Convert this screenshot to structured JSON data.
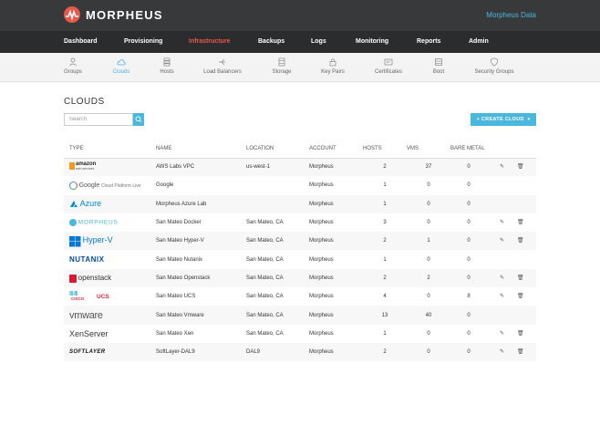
{
  "header": {
    "brand": "MORPHEUS",
    "tenant": "Morpheus Data"
  },
  "main_nav": [
    {
      "label": "Dashboard",
      "active": false
    },
    {
      "label": "Provisioning",
      "active": false
    },
    {
      "label": "Infrastructure",
      "active": true
    },
    {
      "label": "Backups",
      "active": false
    },
    {
      "label": "Logs",
      "active": false
    },
    {
      "label": "Monitoring",
      "active": false
    },
    {
      "label": "Reports",
      "active": false
    },
    {
      "label": "Admin",
      "active": false
    }
  ],
  "sub_nav": [
    {
      "label": "Groups",
      "icon": "groups-icon",
      "active": false
    },
    {
      "label": "Clouds",
      "icon": "cloud-icon",
      "active": true
    },
    {
      "label": "Hosts",
      "icon": "hosts-icon",
      "active": false
    },
    {
      "label": "Load Balancers",
      "icon": "load-balancer-icon",
      "active": false
    },
    {
      "label": "Storage",
      "icon": "storage-icon",
      "active": false
    },
    {
      "label": "Key Pairs",
      "icon": "lock-icon",
      "active": false
    },
    {
      "label": "Certificates",
      "icon": "certificate-icon",
      "active": false
    },
    {
      "label": "Boot",
      "icon": "boot-icon",
      "active": false
    },
    {
      "label": "Security Groups",
      "icon": "shield-icon",
      "active": false
    }
  ],
  "page": {
    "title": "CLOUDS",
    "search_placeholder": "Search",
    "create_button": "+ CREATE CLOUD",
    "create_dropdown_icon": "chevron-down-icon"
  },
  "table": {
    "headers": [
      "TYPE",
      "NAME",
      "LOCATION",
      "ACCOUNT",
      "HOSTS",
      "VMS",
      "BARE METAL"
    ],
    "rows": [
      {
        "type": "amazon-web-services-logo",
        "name": "AWS Labs VPC",
        "location": "us-west-1",
        "account": "Morpheus",
        "hosts": "2",
        "vms": "37",
        "bare_metal": "0",
        "actions": true
      },
      {
        "type": "google-cloud-platform-logo",
        "name": "Google",
        "location": "",
        "account": "Morpheus",
        "hosts": "1",
        "vms": "0",
        "bare_metal": "0",
        "actions": false
      },
      {
        "type": "azure-logo",
        "name": "Morpheus Azure Lab",
        "location": "",
        "account": "Morpheus",
        "hosts": "1",
        "vms": "0",
        "bare_metal": "0",
        "actions": false
      },
      {
        "type": "morpheus-logo",
        "name": "San Mateo Docker",
        "location": "San Mateo, CA",
        "account": "Morpheus",
        "hosts": "3",
        "vms": "0",
        "bare_metal": "0",
        "actions": true
      },
      {
        "type": "hyper-v-logo",
        "name": "San Mateo Hyper-V",
        "location": "San Mateo, CA",
        "account": "Morpheus",
        "hosts": "2",
        "vms": "1",
        "bare_metal": "0",
        "actions": true
      },
      {
        "type": "nutanix-logo",
        "name": "San Mateo Nutanix",
        "location": "San Mateo, CA",
        "account": "Morpheus",
        "hosts": "1",
        "vms": "0",
        "bare_metal": "0",
        "actions": false
      },
      {
        "type": "openstack-logo",
        "name": "San Mateo Openstack",
        "location": "San Mateo, CA",
        "account": "Morpheus",
        "hosts": "2",
        "vms": "2",
        "bare_metal": "0",
        "actions": true
      },
      {
        "type": "cisco-ucs-logo",
        "name": "San Mateo UCS",
        "location": "San Mateo, CA",
        "account": "Morpheus",
        "hosts": "4",
        "vms": "0",
        "bare_metal": "8",
        "actions": true
      },
      {
        "type": "vmware-logo",
        "name": "San Mateo Vmware",
        "location": "San Mateo, CA",
        "account": "Morpheus",
        "hosts": "13",
        "vms": "40",
        "bare_metal": "0",
        "actions": false
      },
      {
        "type": "xenserver-logo",
        "name": "San Mateo Xen",
        "location": "San Mateo, CA",
        "account": "Morpheus",
        "hosts": "1",
        "vms": "0",
        "bare_metal": "0",
        "actions": true
      },
      {
        "type": "softlayer-logo",
        "name": "SoftLayer-DAL9",
        "location": "DAL9",
        "account": "Morpheus",
        "hosts": "2",
        "vms": "0",
        "bare_metal": "0",
        "actions": true
      }
    ],
    "logo_text": {
      "amazon": "amazon",
      "amazon_sub": "web services",
      "google": "Google",
      "google_sub": "Cloud Platform Live",
      "azure": "Azure",
      "morpheus": "MORPHEUS",
      "hyperv": "Hyper-V",
      "nutanix": "NUTANIX",
      "openstack": "openstack",
      "cisco": "CISCO",
      "ucs": "UCS",
      "vmware": "vmware",
      "xen": "XenServer",
      "softlayer": "SOFTLAYER"
    }
  },
  "colors": {
    "accent": "#4ab7dd",
    "brand_red": "#e9574a",
    "topbar": "#38393b",
    "nav": "#2b2c2e"
  }
}
